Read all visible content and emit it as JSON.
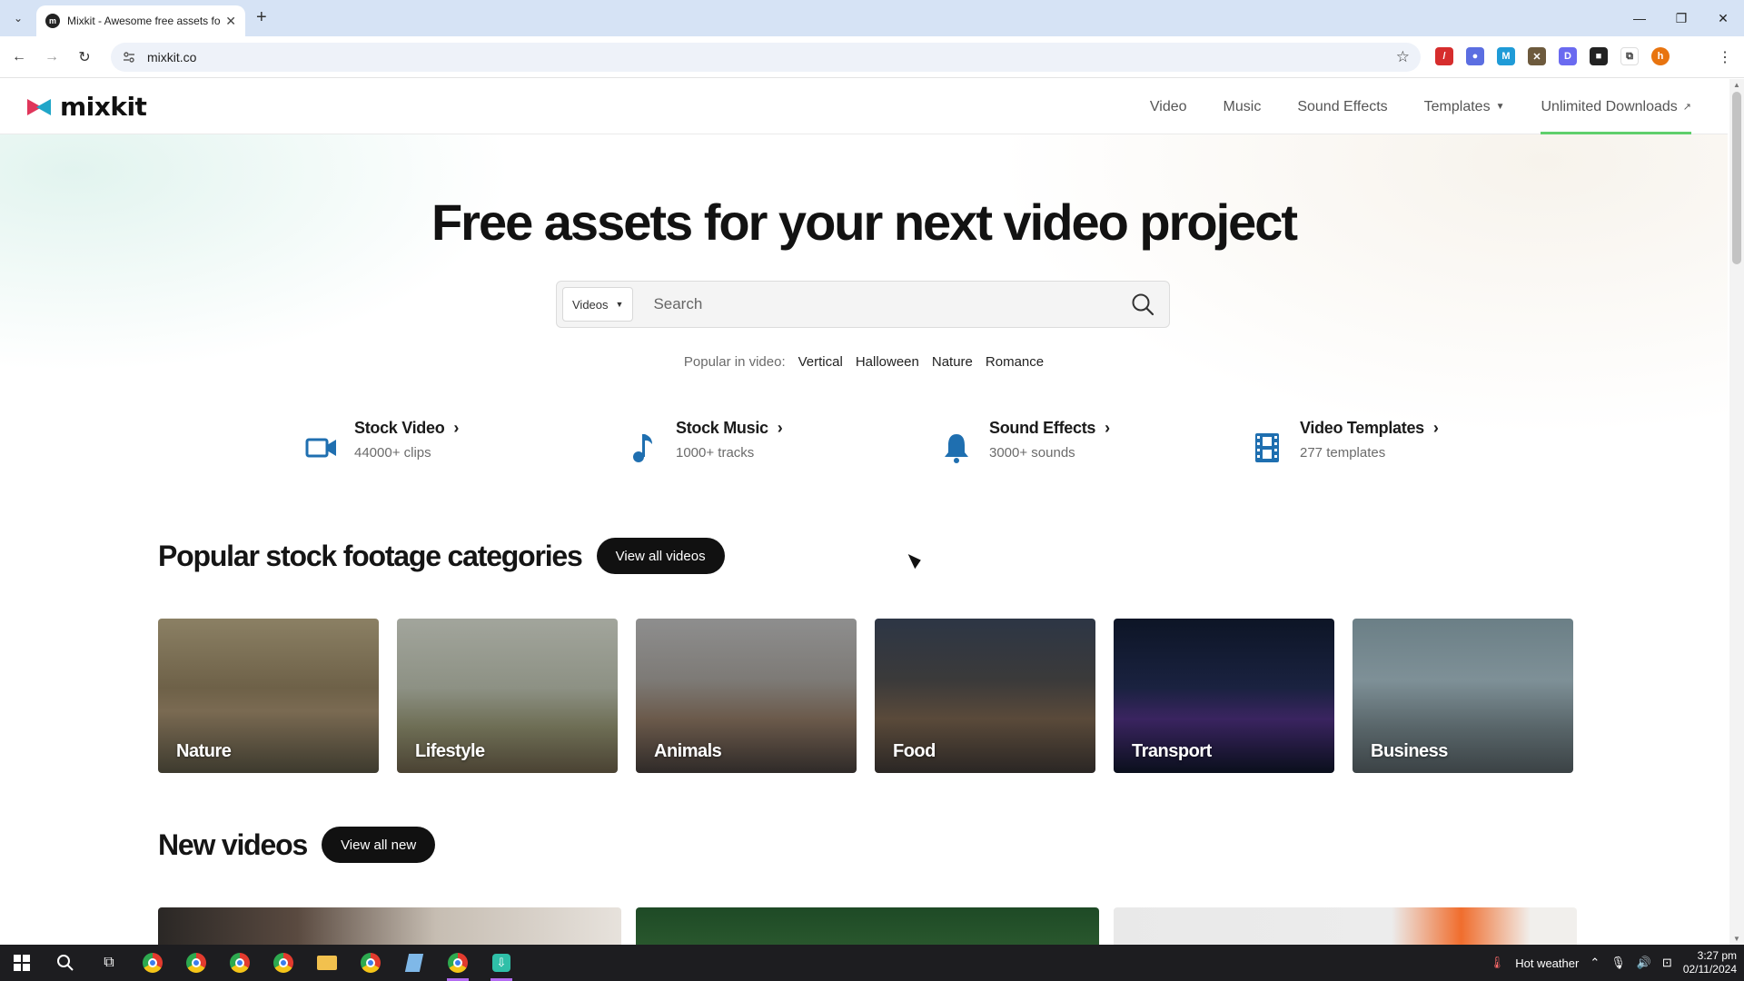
{
  "browser": {
    "tab_title": "Mixkit - Awesome free assets fo",
    "tab_favicon": "m",
    "url": "mixkit.co",
    "extensions": [
      {
        "name": "pen-extension-icon",
        "color": "#d62d2d",
        "glyph": "/"
      },
      {
        "name": "color-extension-icon",
        "color": "#5b6ee1",
        "glyph": "●"
      },
      {
        "name": "m-extension-icon",
        "color": "#1f9bd7",
        "glyph": "M"
      },
      {
        "name": "tools-extension-icon",
        "color": "#6d5a3d",
        "glyph": "✕"
      },
      {
        "name": "d-extension-icon",
        "color": "#6a6af0",
        "glyph": "D"
      },
      {
        "name": "square-extension-icon",
        "color": "#222222",
        "glyph": "■"
      },
      {
        "name": "puzzle-extension-icon",
        "color": "#ffffff",
        "glyph": "⧉"
      },
      {
        "name": "profile-avatar",
        "color": "#e8740f",
        "glyph": "h"
      }
    ]
  },
  "site": {
    "logo_text": "mixkit",
    "nav": {
      "video": "Video",
      "music": "Music",
      "sound_effects": "Sound Effects",
      "templates": "Templates",
      "unlimited": "Unlimited Downloads"
    },
    "accent_color": "#5fcf6c"
  },
  "hero": {
    "title": "Free assets for your next video project",
    "search_type": "Videos",
    "search_placeholder": "Search",
    "popular_lead": "Popular in video:",
    "popular_tags": [
      "Vertical",
      "Halloween",
      "Nature",
      "Romance"
    ]
  },
  "features": [
    {
      "title": "Stock Video",
      "sub": "44000+ clips",
      "icon": "video-camera-icon"
    },
    {
      "title": "Stock Music",
      "sub": "1000+ tracks",
      "icon": "music-note-icon"
    },
    {
      "title": "Sound Effects",
      "sub": "3000+ sounds",
      "icon": "bell-icon"
    },
    {
      "title": "Video Templates",
      "sub": "277 templates",
      "icon": "film-strip-icon"
    }
  ],
  "categories_section": {
    "title": "Popular stock footage categories",
    "button": "View all videos",
    "items": [
      "Nature",
      "Lifestyle",
      "Animals",
      "Food",
      "Transport",
      "Business"
    ]
  },
  "new_section": {
    "title": "New videos",
    "button": "View all new"
  },
  "taskbar": {
    "weather": "Hot weather",
    "time": "3:27 pm",
    "date": "02/11/2024"
  }
}
